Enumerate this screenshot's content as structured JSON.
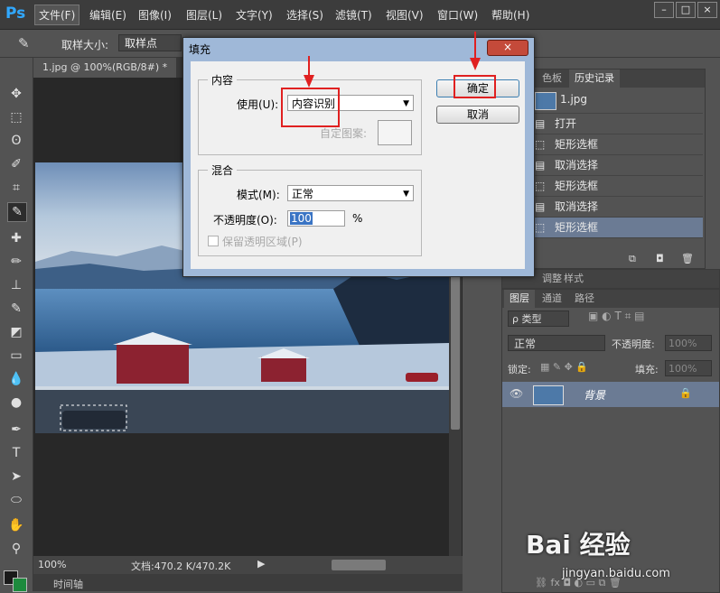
{
  "app": {
    "logo": "Ps"
  },
  "menu": [
    "文件(F)",
    "编辑(E)",
    "图像(I)",
    "图层(L)",
    "文字(Y)",
    "选择(S)",
    "滤镜(T)",
    "视图(V)",
    "窗口(W)",
    "帮助(H)"
  ],
  "options_bar": {
    "sample_size_label": "取样大小:",
    "sample_size_value": "取样点"
  },
  "document": {
    "tab_title": "1.jpg @ 100%(RGB/8#) *",
    "zoom": "100%",
    "doc_size": "文档:470.2 K/470.2K",
    "timeline": "时间轴"
  },
  "history_panel": {
    "tabs": [
      "色板",
      "历史记录"
    ],
    "snapshot": "1.jpg",
    "items": [
      "打开",
      "矩形选框",
      "取消选择",
      "矩形选框",
      "取消选择",
      "矩形选框"
    ]
  },
  "layers_panel": {
    "top_tabs": [
      "调整",
      "样式"
    ],
    "tabs": [
      "图层",
      "通道",
      "路径"
    ],
    "filter_label": "ρ 类型",
    "blend_mode": "正常",
    "opacity_label": "不透明度:",
    "opacity_value": "100%",
    "lock_label": "锁定:",
    "fill_label": "填充:",
    "fill_value": "100%",
    "layer_name": "背景"
  },
  "dialog": {
    "title": "填充",
    "content_group": "内容",
    "use_label": "使用(U):",
    "use_value": "内容识别",
    "custom_pattern_label": "自定图案:",
    "blend_group": "混合",
    "mode_label": "模式(M):",
    "mode_value": "正常",
    "opacity_label": "不透明度(O):",
    "opacity_value": "100",
    "percent": "%",
    "preserve_label": "保留透明区域(P)",
    "ok": "确定",
    "cancel": "取消",
    "close": "×"
  },
  "watermark": {
    "brand": "Bai 经验",
    "url": "jingyan.baidu.com"
  },
  "colors": {
    "accent_red": "#e02020",
    "selection_blue": "#3a74c4"
  }
}
